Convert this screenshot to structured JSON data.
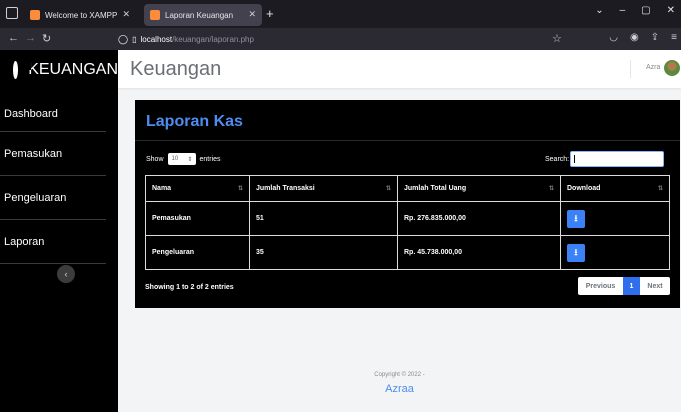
{
  "browser": {
    "tabs": [
      {
        "title": "Welcome to XAMPP"
      },
      {
        "title": "Laporan Keuangan"
      }
    ],
    "new_tab": "+",
    "url_host": "localhost",
    "url_path": "/keuangan/laporan.php"
  },
  "sidebar": {
    "brand": "KEUANGAN",
    "items": [
      {
        "label": "Dashboard"
      },
      {
        "label": "Pemasukan"
      },
      {
        "label": "Pengeluaran"
      },
      {
        "label": "Laporan"
      }
    ],
    "collapse_glyph": "‹"
  },
  "topbar": {
    "title": "Keuangan",
    "user_name": "Azra"
  },
  "card": {
    "title": "Laporan Kas",
    "show_label": "Show",
    "entries_value": "10",
    "entries_label": "entries",
    "search_label": "Search:",
    "search_value": "",
    "table": {
      "headers": [
        "Nama",
        "Jumlah Transaksi",
        "Jumlah Total Uang",
        "Download"
      ],
      "rows": [
        {
          "nama": "Pemasukan",
          "jumlah": "51",
          "total": "Rp. 276.835.000,00"
        },
        {
          "nama": "Pengeluaran",
          "jumlah": "35",
          "total": "Rp. 45.738.000,00"
        }
      ]
    },
    "info": "Showing 1 to 2 of 2 entries",
    "pager": {
      "prev": "Previous",
      "current": "1",
      "next": "Next"
    }
  },
  "footer": {
    "copyright": "Copyright © 2022 -",
    "brand": "Azraa"
  },
  "colors": {
    "accent": "#4e8cf0",
    "button": "#3b82f6",
    "sidebar": "#000000"
  }
}
